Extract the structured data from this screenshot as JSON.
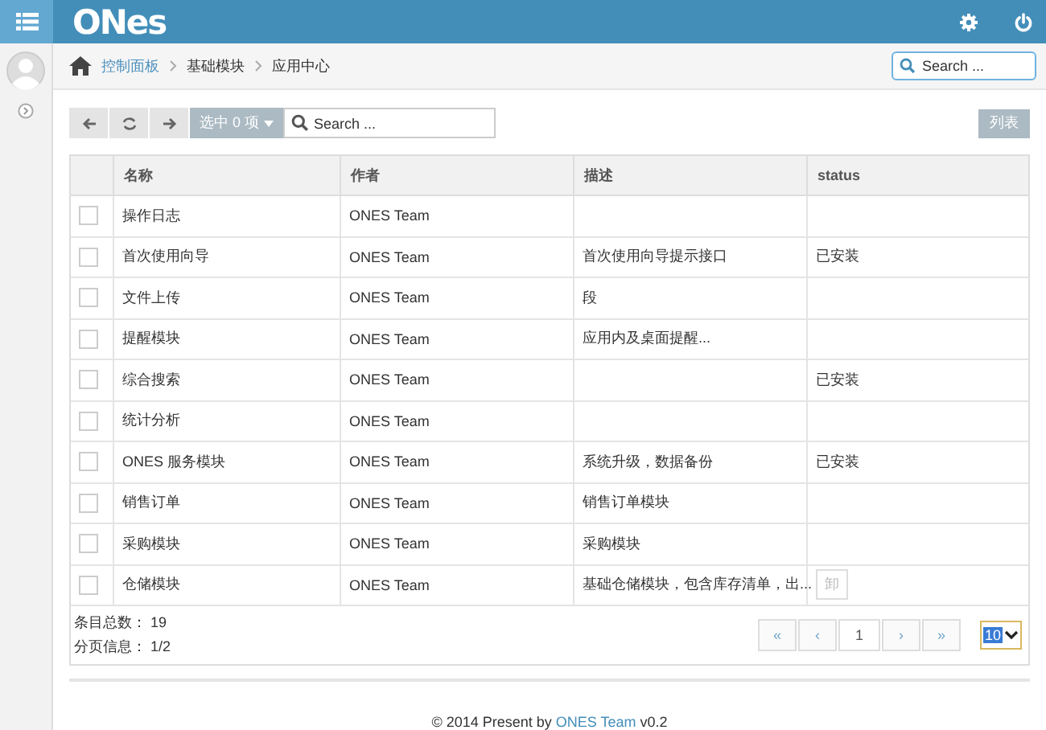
{
  "navbar": {
    "brand": "ONes"
  },
  "breadcrumbs": [
    {
      "label": "控制面板",
      "link": true
    },
    {
      "label": "基础模块",
      "link": false
    },
    {
      "label": "应用中心",
      "link": false
    }
  ],
  "top_search": {
    "placeholder": "Search ..."
  },
  "toolbar": {
    "selection": "选中 0 项",
    "search_placeholder": "Search ...",
    "view_button": "列表"
  },
  "table": {
    "columns": [
      "名称",
      "作者",
      "描述",
      "status"
    ],
    "rows": [
      {
        "checked": false,
        "name": "操作日志",
        "author": "ONES Team",
        "description": "",
        "status": ""
      },
      {
        "checked": false,
        "name": "首次使用向导",
        "author": "ONES Team",
        "description": "首次使用向导提示接口",
        "status": "已安装"
      },
      {
        "checked": false,
        "name": "文件上传",
        "author": "ONES Team",
        "description": "段",
        "status": ""
      },
      {
        "checked": false,
        "name": "提醒模块",
        "author": "ONES Team",
        "description": "应用内及桌面提醒...",
        "status": ""
      },
      {
        "checked": false,
        "name": "综合搜索",
        "author": "ONES Team",
        "description": "",
        "status": "已安装"
      },
      {
        "checked": false,
        "name": "统计分析",
        "author": "ONES Team",
        "description": "",
        "status": ""
      },
      {
        "checked": false,
        "name": "ONES 服务模块",
        "author": "ONES Team",
        "description": "系统升级，数据备份",
        "status": "已安装"
      },
      {
        "checked": false,
        "name": "销售订单",
        "author": "ONES Team",
        "description": "销售订单模块",
        "status": ""
      },
      {
        "checked": false,
        "name": "采购模块",
        "author": "ONES Team",
        "description": "采购模块",
        "status": ""
      },
      {
        "checked": false,
        "name": "仓储模块",
        "author": "ONES Team",
        "description": "基础仓储模块，包含库存清单，出...",
        "status": "",
        "action": "卸"
      }
    ]
  },
  "summary": [
    "条目总数： 19",
    "分页信息： 1/2"
  ],
  "pagination": {
    "first": "«",
    "prev": "‹",
    "page": "1",
    "next": "›",
    "last": "»",
    "page_size": "10"
  },
  "footer": {
    "prefix": "© 2014 Present by ",
    "link": "ONES Team",
    "suffix": " v0.2"
  }
}
